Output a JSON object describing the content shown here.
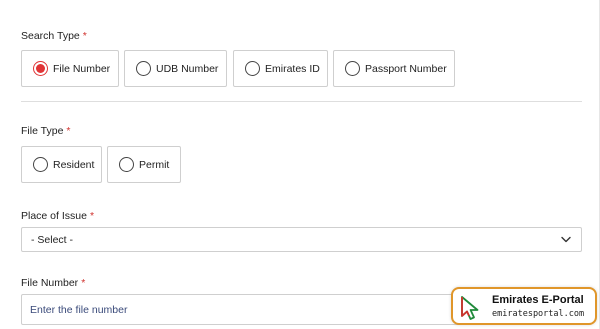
{
  "search_type": {
    "label": "Search Type",
    "required_mark": "*",
    "options": [
      {
        "label": "File Number",
        "checked": true
      },
      {
        "label": "UDB Number",
        "checked": false
      },
      {
        "label": "Emirates ID",
        "checked": false
      },
      {
        "label": "Passport Number",
        "checked": false
      }
    ]
  },
  "file_type": {
    "label": "File Type",
    "required_mark": "*",
    "options": [
      {
        "label": "Resident",
        "checked": false
      },
      {
        "label": "Permit",
        "checked": false
      }
    ]
  },
  "place_of_issue": {
    "label": "Place of Issue",
    "required_mark": "*",
    "selected": "- Select -"
  },
  "file_number": {
    "label": "File Number",
    "required_mark": "*",
    "placeholder": "Enter the file number",
    "value": ""
  },
  "watermark": {
    "title": "Emirates E-Portal",
    "subtitle": "emiratesportal.com"
  },
  "colors": {
    "accent_red": "#e03436",
    "border": "#cfcfcf",
    "watermark_border": "#e0962a"
  },
  "icons": {
    "select_caret": "chevron-down-icon",
    "watermark_logo": "cursor-arrow-icon"
  }
}
